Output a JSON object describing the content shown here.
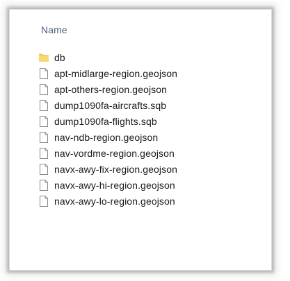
{
  "column_header": "Name",
  "files": [
    {
      "name": "db",
      "type": "folder",
      "icon": "folder-icon",
      "color": "#f2c55c"
    },
    {
      "name": "apt-midlarge-region.geojson",
      "type": "file",
      "icon": "file-icon"
    },
    {
      "name": "apt-others-region.geojson",
      "type": "file",
      "icon": "file-icon"
    },
    {
      "name": "dump1090fa-aircrafts.sqb",
      "type": "file",
      "icon": "file-icon"
    },
    {
      "name": "dump1090fa-flights.sqb",
      "type": "file",
      "icon": "file-icon"
    },
    {
      "name": "nav-ndb-region.geojson",
      "type": "file",
      "icon": "file-icon"
    },
    {
      "name": "nav-vordme-region.geojson",
      "type": "file",
      "icon": "file-icon"
    },
    {
      "name": "navx-awy-fix-region.geojson",
      "type": "file",
      "icon": "file-icon"
    },
    {
      "name": "navx-awy-hi-region.geojson",
      "type": "file",
      "icon": "file-icon"
    },
    {
      "name": "navx-awy-lo-region.geojson",
      "type": "file",
      "icon": "file-icon"
    }
  ]
}
